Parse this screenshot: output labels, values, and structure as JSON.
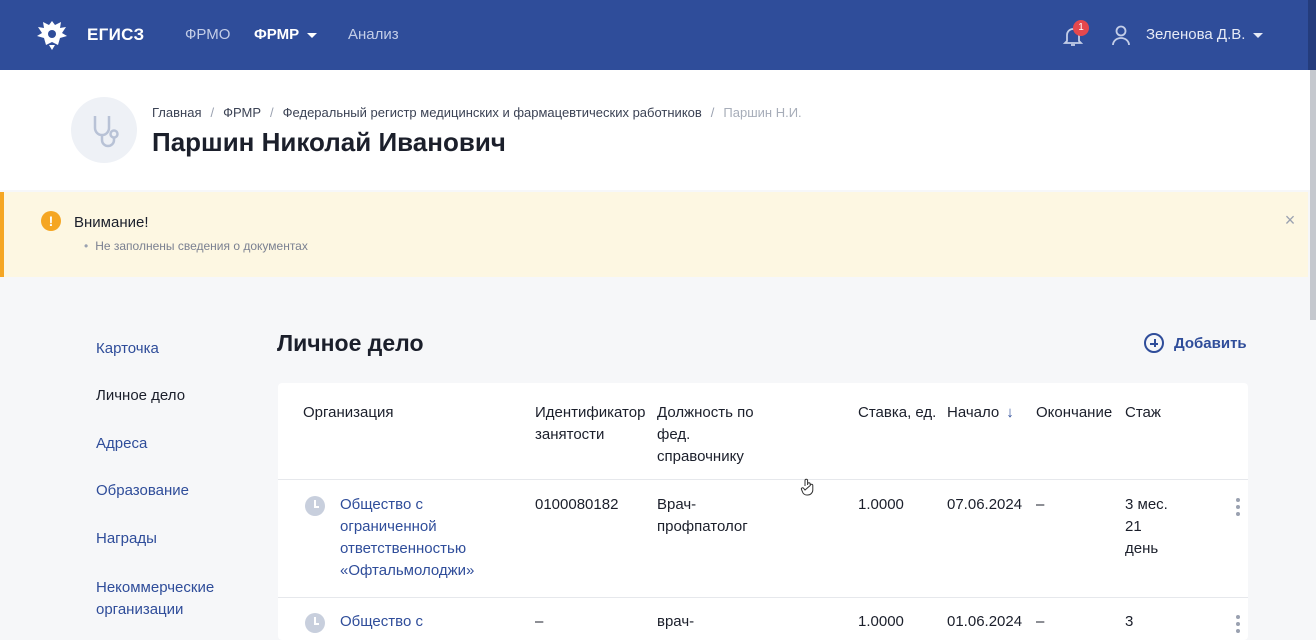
{
  "topbar": {
    "brand": "ЕГИСЗ",
    "nav": [
      {
        "label": "ФРМО"
      },
      {
        "label": "ФРМР"
      },
      {
        "label": "Анализ"
      }
    ],
    "notifications_count": "1",
    "user_name": "Зеленова Д.В."
  },
  "header": {
    "breadcrumb": [
      "Главная",
      "ФРМР",
      "Федеральный регистр медицинских и фармацевтических работников",
      "Паршин Н.И."
    ],
    "title": "Паршин Николай Иванович",
    "avatar_icon": "stethoscope-icon"
  },
  "warning": {
    "title": "Внимание!",
    "items": [
      "Не заполнены сведения о документах"
    ]
  },
  "sidebar": {
    "items": [
      {
        "label": "Карточка"
      },
      {
        "label": "Личное дело"
      },
      {
        "label": "Адреса"
      },
      {
        "label": "Образование"
      },
      {
        "label": "Награды"
      },
      {
        "label": "Некоммерческие организации"
      }
    ],
    "active": "Личное дело"
  },
  "main": {
    "title": "Личное дело",
    "add_label": "Добавить",
    "columns": [
      "Организация",
      "Идентификатор занятости",
      "Должность по фед. справочнику",
      "Ставка, ед.",
      "Начало",
      "Окончание",
      "Стаж"
    ],
    "rows": [
      {
        "organization": "Общество с ограниченной ответственностью «Офтальмолоджи»",
        "employment_id": "0100080182",
        "position": "Врач-профпатолог",
        "rate": "1.0000",
        "start": "07.06.2024",
        "end": "–",
        "experience": "3 мес. 21 день"
      },
      {
        "organization": "Общество с",
        "employment_id": "–",
        "position": "врач-",
        "rate": "1.0000",
        "start": "01.06.2024",
        "end": "–",
        "experience": "3"
      }
    ]
  },
  "colors": {
    "topbar": "#2f4d9a",
    "link": "#2f4d9a",
    "warning_bg": "#fdf7e2",
    "warning_accent": "#f5a623",
    "badge": "#e5484d"
  }
}
